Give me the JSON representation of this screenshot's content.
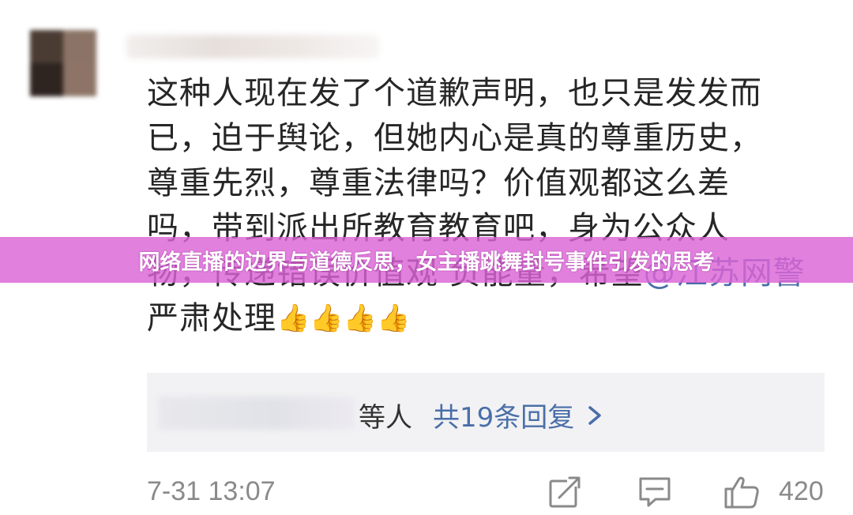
{
  "comment": {
    "text_lines": [
      "这种人现在发了个道歉声明，也只是发发而",
      "已，迫于舆论，但她内心是真的尊重历史，",
      "尊重先烈，尊重法律吗？价值观都这么差",
      "吗，带到派出所教育教育吧，身为公众人",
      "物，传递错误价值观 负能量，希望"
    ],
    "mention": "@江苏网警",
    "last_line_text": " 严肃处理",
    "emoji": "👍👍👍👍"
  },
  "banner": {
    "title": "网络直播的边界与道德反思，女主播跳舞封号事件引发的思考",
    "color": "#dc64d7"
  },
  "replies": {
    "suffix": "等人",
    "link_label": "共19条回复",
    "chevron_icon": "chevron-right-icon"
  },
  "footer": {
    "timestamp": "7-31 13:07",
    "like_count": "420",
    "icons": [
      "repost-icon",
      "reply-icon",
      "like-icon"
    ]
  },
  "colors": {
    "link": "#4a6fa8",
    "meta_text": "#8a8a8a",
    "reply_box": "#f2f2f4"
  }
}
